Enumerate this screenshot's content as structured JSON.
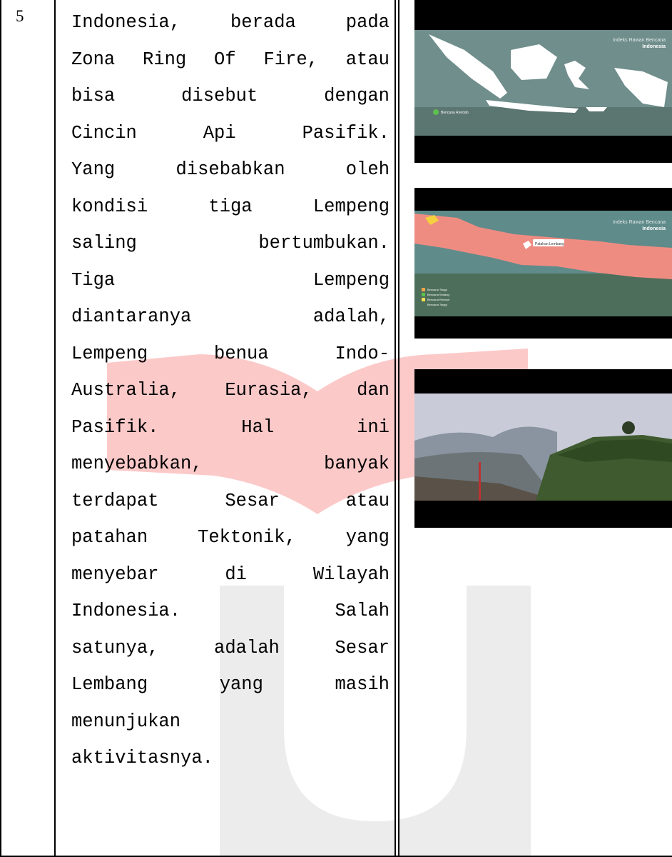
{
  "row": {
    "number": "5"
  },
  "paragraph_lines": [
    [
      "Indonesia,",
      "berada",
      "pada"
    ],
    [
      "Zona",
      "Ring",
      "Of",
      "Fire,",
      "atau"
    ],
    [
      "bisa",
      "disebut",
      "dengan"
    ],
    [
      "Cincin",
      "Api",
      "Pasifik."
    ],
    [
      "Yang",
      "disebabkan",
      "oleh"
    ],
    [
      "kondisi",
      "tiga",
      "Lempeng"
    ],
    [
      "saling",
      "bertumbukan."
    ],
    [
      "Tiga",
      "Lempeng"
    ],
    [
      "diantaranya",
      "adalah,"
    ],
    [
      "Lempeng",
      "benua",
      "Indo-"
    ],
    [
      "Australia,",
      "Eurasia,",
      "dan"
    ],
    [
      "Pasifik.",
      "Hal",
      "ini"
    ],
    [
      "menyebabkan,",
      "banyak"
    ],
    [
      "terdapat",
      "Sesar",
      "atau"
    ],
    [
      "patahan",
      "Tektonik,",
      "yang"
    ],
    [
      "menyebar",
      "di",
      "Wilayah"
    ],
    [
      "Indonesia.",
      "Salah"
    ],
    [
      "satunya,",
      "adalah",
      "Sesar"
    ],
    [
      "Lembang",
      "yang",
      "masih"
    ],
    [
      "menunjukan"
    ],
    [
      "aktivitasnya."
    ]
  ],
  "screenshots": {
    "map_indonesia": {
      "title": "Indeks Rawan Bencana",
      "subtitle": "Indonesia",
      "legend": [
        "Bencana Rendah"
      ],
      "colors": {
        "land": "#ffffff",
        "background": "#6f8e8c",
        "legend": "#5cbf4f"
      }
    },
    "map_java": {
      "title": "Indeks Rawan Bencana",
      "subtitle": "Indonesia",
      "callout": "Patahan Lembang",
      "legend": [
        "Bencana Tinggi",
        "Bencana Sedang",
        "Bencana Rendah",
        "Bencana Tinggi"
      ],
      "colors": {
        "land": "#ef8c82",
        "background": "#5f8b8a"
      }
    },
    "landscape": {
      "colors": {
        "sky": "#c9ccd8",
        "hill": "#3e5a2e"
      }
    }
  },
  "watermark": {
    "colors": {
      "book": "#fcc9c9",
      "u": "#ececec"
    }
  },
  "justified_line_indices": [
    0,
    1,
    2,
    3,
    4,
    5,
    6,
    7,
    8,
    9,
    10,
    11,
    12,
    13,
    14,
    15,
    16,
    17,
    18
  ]
}
